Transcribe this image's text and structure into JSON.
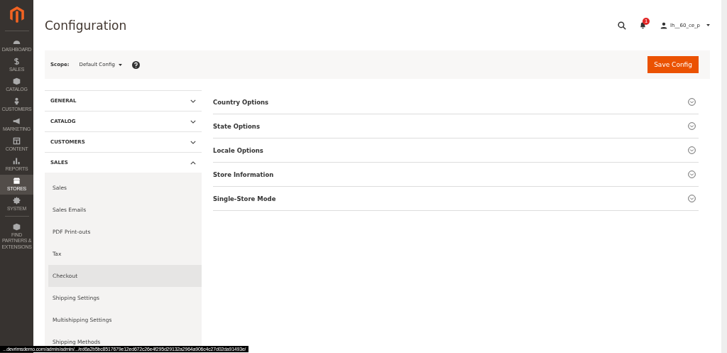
{
  "menu": [
    {
      "label": "DASHBOARD",
      "selected": false
    },
    {
      "label": "SALES",
      "selected": false
    },
    {
      "label": "CATALOG",
      "selected": false
    },
    {
      "label": "CUSTOMERS",
      "selected": false
    },
    {
      "label": "MARKETING",
      "selected": false
    },
    {
      "label": "CONTENT",
      "selected": false
    },
    {
      "label": "REPORTS",
      "selected": false
    },
    {
      "label": "STORES",
      "selected": true
    },
    {
      "label": "SYSTEM",
      "selected": false
    },
    {
      "label": "FIND PARTNERS & EXTENSIONS",
      "selected": false
    }
  ],
  "page_title": "Configuration",
  "header": {
    "notification_count": "1",
    "user": "lh__60_ce_p"
  },
  "scope": {
    "label": "Scope:",
    "value": "Default Config"
  },
  "save_button": "Save Config",
  "sections": [
    {
      "label": "GENERAL",
      "expanded": false
    },
    {
      "label": "CATALOG",
      "expanded": false
    },
    {
      "label": "CUSTOMERS",
      "expanded": false
    },
    {
      "label": "SALES",
      "expanded": true,
      "children": [
        {
          "label": "Sales",
          "selected": false
        },
        {
          "label": "Sales Emails",
          "selected": false
        },
        {
          "label": "PDF Print-outs",
          "selected": false
        },
        {
          "label": "Tax",
          "selected": false
        },
        {
          "label": "Checkout",
          "selected": true
        },
        {
          "label": "Shipping Settings",
          "selected": false
        },
        {
          "label": "Multishipping Settings",
          "selected": false
        },
        {
          "label": "Shipping Methods",
          "selected": false
        }
      ]
    }
  ],
  "groups": [
    {
      "label": "Country Options",
      "expanded": false
    },
    {
      "label": "State Options",
      "expanded": false
    },
    {
      "label": "Locale Options",
      "expanded": false
    },
    {
      "label": "Store Information",
      "expanded": false
    },
    {
      "label": "Single-Store Mode",
      "expanded": false
    }
  ],
  "status_bar": "...devrimsdemo.com/admin/admin/.../ed6a2b5bc8517679e12ed672c26e4f295d29132a2964a906c4c27d02da91493e/"
}
